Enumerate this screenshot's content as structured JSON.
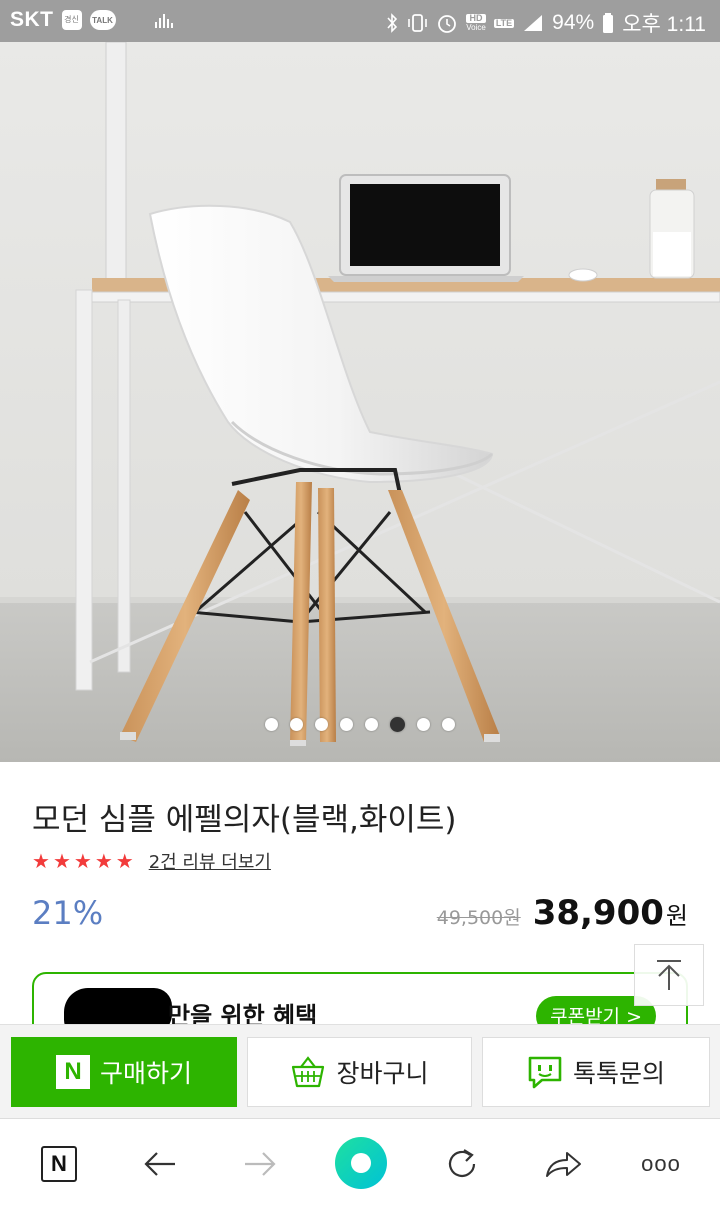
{
  "status_bar": {
    "carrier": "SKT",
    "badge_label": "경신",
    "talk_label": "TALK",
    "hd_label": "HD",
    "hd_sub": "Voice",
    "lte_label": "LTE",
    "battery": "94%",
    "time": "오후 1:11"
  },
  "gallery": {
    "slide_count": 8,
    "active_index": 5
  },
  "product": {
    "title": "모던 심플 에펠의자(블랙,화이트)",
    "rating_stars": 5,
    "review_link": "2건 리뷰 더보기",
    "discount": "21%",
    "original_price": "49,500원",
    "price": "38,900",
    "currency": "원"
  },
  "benefit": {
    "text": "만을 위한 혜택",
    "coupon_button": "쿠폰받기 >"
  },
  "actions": {
    "buy_logo": "N",
    "buy": "구매하기",
    "cart": "장바구니",
    "talk": "톡톡문의"
  },
  "toolbar": {
    "home_logo": "N",
    "more": "ooo"
  },
  "colors": {
    "brand_green": "#2db400",
    "discount_blue": "#5b7ec2",
    "star_red": "#f23b3b",
    "status_bar_gray": "#9e9e9e"
  }
}
